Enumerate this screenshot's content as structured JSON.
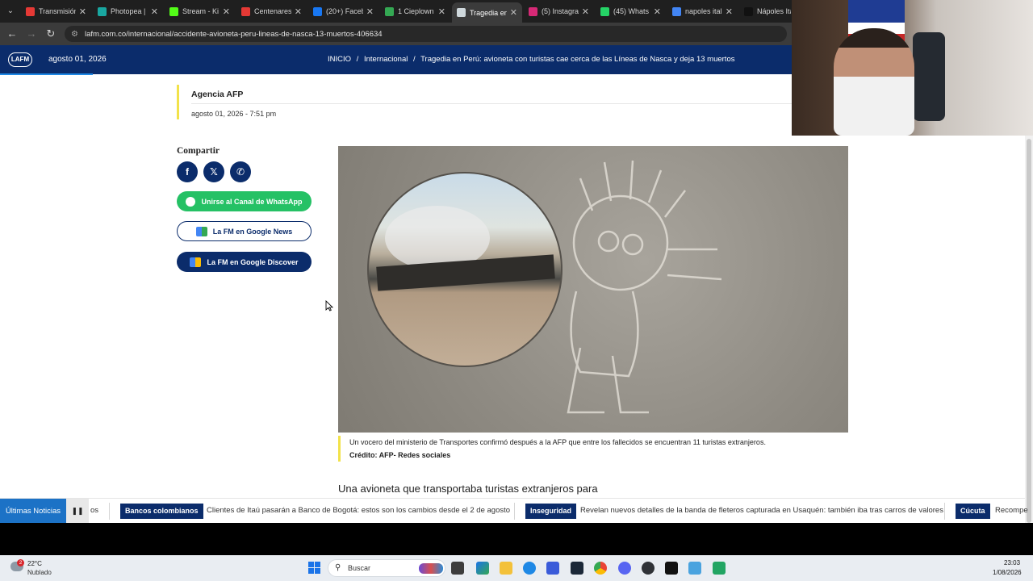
{
  "tabs": [
    {
      "label": "Transmisión",
      "color": "#e53935"
    },
    {
      "label": "Photopea |",
      "color": "#19a7a1"
    },
    {
      "label": "Stream - Ki",
      "color": "#53fc18"
    },
    {
      "label": "Centenares",
      "color": "#e53935"
    },
    {
      "label": "(20+) Faceb",
      "color": "#1877f2"
    },
    {
      "label": "1 Cieplown",
      "color": "#34a853"
    },
    {
      "label": "Tragedia en",
      "color": "#cfd8dc",
      "active": true
    },
    {
      "label": "(5) Instagra",
      "color": "#d62976"
    },
    {
      "label": "(45) Whats",
      "color": "#25d366"
    },
    {
      "label": "napoles ital",
      "color": "#4285f4"
    },
    {
      "label": "Nápoles Ita",
      "color": "#111111"
    }
  ],
  "browser": {
    "url": "lafm.com.co/internacional/accidente-avioneta-peru-lineas-de-nasca-13-muertos-406634"
  },
  "header": {
    "logo": "LAFM",
    "date": "agosto 01, 2026",
    "breadcrumb": {
      "home": "INICIO",
      "section": "Internacional",
      "current": "Tragedia en Perú: avioneta con turistas cae cerca de las Líneas de Nasca y deja 13 muertos",
      "sep": "/"
    }
  },
  "article": {
    "author": "Agencia AFP",
    "published": "agosto 01, 2026 - 7:51 pm",
    "caption": "Un vocero del ministerio de Transportes confirmó después a la AFP que entre los fallecidos se encuentran 11 turistas extranjeros.",
    "credit": "Crédito: AFP- Redes sociales",
    "lead": "Una avioneta que transportaba turistas extranjeros para"
  },
  "share": {
    "title": "Compartir",
    "facebook": "f",
    "x": "𝕏",
    "whatsapp": "✆",
    "whatsapp_channel": "Unirse al Canal de WhatsApp",
    "google_news": "La FM en Google News",
    "google_discover": "La FM en Google Discover"
  },
  "ticker": {
    "label": "Últimas Noticias",
    "pause": "❚❚",
    "fragment": "os",
    "items": [
      {
        "tag": "Bancos colombianos",
        "text": "Clientes de Itaú pasarán a Banco de Bogotá: estos son los cambios desde el 2 de agosto"
      },
      {
        "tag": "Inseguridad",
        "text": "Revelan nuevos detalles de la banda de fleteros capturada en Usaquén: también iba tras carros de valores"
      },
      {
        "tag": "Cúcuta",
        "text": "Recompe"
      }
    ]
  },
  "taskbar": {
    "weather_temp": "22°C",
    "weather_desc": "Nublado",
    "weather_badge": "2",
    "search_label": "Buscar",
    "time": "23:03",
    "date": "1/08/2026"
  },
  "colors": {
    "brand": "#0b2c6b",
    "accent_yellow": "#f2e24a",
    "whatsapp": "#25c165",
    "ticker_label": "#1c72c6"
  }
}
